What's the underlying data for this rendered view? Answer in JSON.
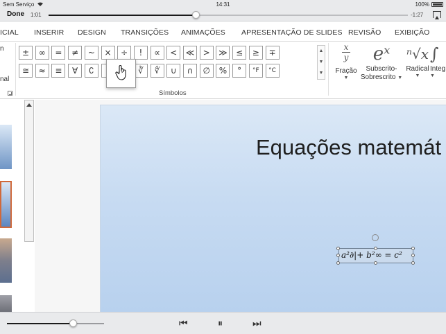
{
  "status": {
    "carrier": "Sem Serviço",
    "time": "14:31",
    "battery": "100%"
  },
  "video": {
    "done_label": "Done",
    "elapsed": "1:01",
    "remaining": "-1:27",
    "progress": 0.41,
    "volume": 0.68
  },
  "tabs": [
    "ICIAL",
    "INSERIR",
    "DESIGN",
    "TRANSIÇÕES",
    "ANIMAÇÕES",
    "APRESENTAÇÃO DE SLIDES",
    "REVISÃO",
    "EXIBIÇÃO"
  ],
  "ribbon": {
    "left_label_top": "n",
    "left_label_bottom": "nal",
    "symbols_row1": [
      "±",
      "∞",
      "=",
      "≠",
      "~",
      "×",
      "÷",
      "!",
      "∝",
      "<",
      "≪",
      ">",
      "≫",
      "≤",
      "≥",
      "∓"
    ],
    "symbols_row2": [
      "≅",
      "≈",
      "≡",
      "∀",
      "∁",
      "",
      "√",
      "∛",
      "∜",
      "∪",
      "∩",
      "∅",
      "%",
      "°",
      "°F",
      "°C"
    ],
    "group_label": "Símbolos",
    "popup_symbol": "∂",
    "fraction": {
      "icon_top": "x",
      "icon_bottom": "y",
      "label": "Fração"
    },
    "script": {
      "icon": "eˣ",
      "label_1": "Subscrito-",
      "label_2": "Sobrescrito"
    },
    "radical": {
      "icon": "ⁿ√x",
      "label": "Radical"
    },
    "integral": {
      "icon": "∫",
      "label": "Integ"
    }
  },
  "slide": {
    "title": "Equações matemát",
    "equation": "a²∂|+ b²∞ = c²"
  }
}
